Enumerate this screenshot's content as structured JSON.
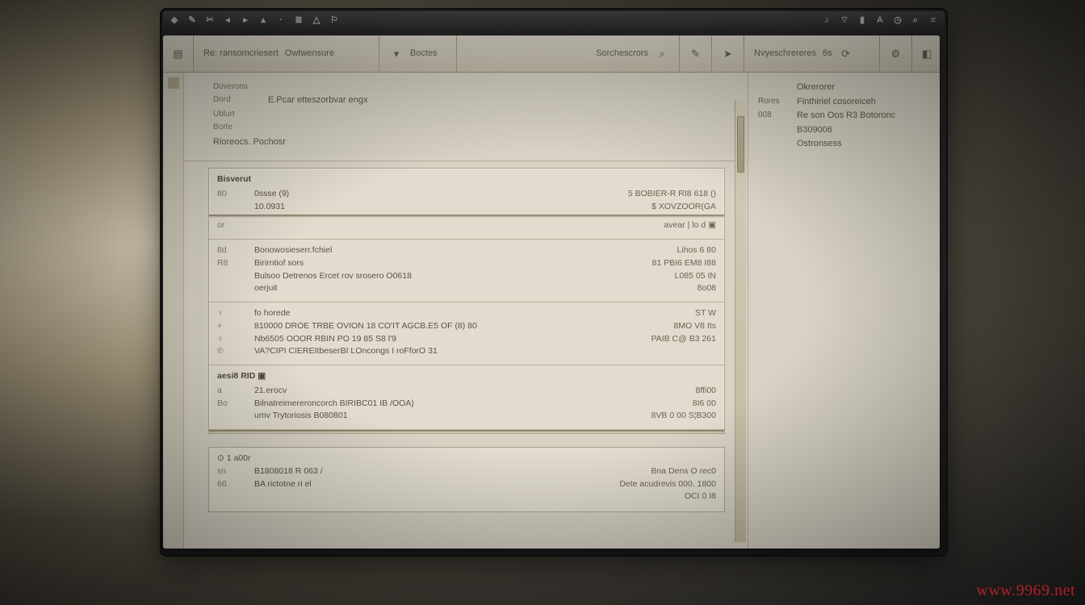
{
  "watermark": "www.9969.net",
  "menubar": {
    "left_icons": [
      "apple",
      "cut",
      "copy",
      "back",
      "fwd",
      "up",
      "sep",
      "list",
      "warn",
      "flag"
    ],
    "right_icons": [
      "vol",
      "wifi",
      "batt",
      "ime",
      "clock",
      "search",
      "menu"
    ]
  },
  "toolbar": {
    "slot_home_icon": "home",
    "slot_a_label1": "Re: ransomcriesert",
    "slot_a_label2": "Owtwensure",
    "slot_a_drop_icon": "chevron-down",
    "slot_b_label": "Boctes",
    "slot_search_label": "Sorchescrors",
    "slot_search_icon": "search",
    "slot_tool1_icon": "pencil",
    "slot_tool2_icon": "arrow",
    "slot_c_label": "Nvyeschrereres",
    "slot_c_value": "6s",
    "slot_c_icon": "refresh",
    "slot_d_icon": "gear",
    "slot_e_icon": "panel"
  },
  "header": {
    "rows": [
      {
        "k": "Doverons",
        "v": ""
      },
      {
        "k": "Dord",
        "v": "E.Pcar etteszorbvar engx"
      },
      {
        "k": "Ublurt",
        "v": ""
      },
      {
        "k": "Borte",
        "v": ""
      }
    ],
    "footer": "Rioreocs. Pochosr"
  },
  "sidebar": {
    "rows": [
      {
        "k": "",
        "v": "Okrerorer"
      },
      {
        "k": "Rores",
        "v": "Finthiriel cosoreiceh"
      },
      {
        "k": "008",
        "v": "Re son Oos  R3   Botoronc"
      },
      {
        "k": "",
        "v": "B309006"
      },
      {
        "k": "",
        "v": "Ostronsess"
      }
    ]
  },
  "records": {
    "blocks": [
      {
        "title": "Bisverut",
        "lines": [
          {
            "c1": "80",
            "c2": "0ssse (9)",
            "c3": "5 BOBIER-R RI8 618 ()"
          },
          {
            "c1": "",
            "c2": "10.0931",
            "c3": "$ XOVZOOR(GA"
          },
          {
            "c1": "or",
            "c2": "",
            "c3": "avear | lo d   ▣",
            "hr": true
          }
        ]
      },
      {
        "lines": [
          {
            "c1": "8d",
            "c2": "Bonowosieserr.fchiel",
            "c3": "Lihos  6  80"
          },
          {
            "c1": "R8",
            "c2": "Birirntiof sors",
            "c3": "81  PBI6  EM8  I88"
          },
          {
            "c1": "",
            "c2": "Bulsoo           Detrenos Ercet      rov srosero O0618",
            "c3": "L085  05  IN"
          },
          {
            "c1": "",
            "c2": "oerjuit",
            "c3": "8o08"
          }
        ]
      },
      {
        "lines": [
          {
            "c1": "♀",
            "c2": "fo horede",
            "c3": "ST W"
          },
          {
            "c1": "+",
            "c2": "810000         DROE TRBE OVION 18   CO'IT AGCB.E5     OF  (8)  80",
            "c3": "8MO V8  Its"
          },
          {
            "c1": "♀",
            "c2": "Nb6505         OOOR  RBIN PO 19        85                              S8 l'9",
            "c3": "PAIB C@  B3  261"
          },
          {
            "c1": "℗",
            "c2": "VA?CIPI CIEREItbeserBI LOncongs  I roFforO 31",
            "c3": ""
          }
        ]
      },
      {
        "title": "aesi8  RID  ▣",
        "lines": [
          {
            "c1": "a",
            "c2": "21.erocv",
            "c3": "8ffi00"
          },
          {
            "c1": "Bo",
            "c2": "Bilnatreimereroncorch     BIRIBC01     IB /OOA)",
            "c3": "8I6 00"
          },
          {
            "c1": "",
            "c2": "umv  Trytoriosis           B080801",
            "c3": "8VB 0 00   S¦B300"
          }
        ]
      }
    ],
    "bottom_bar": "▣"
  },
  "footer_block": {
    "title": "⊙  1 a00r",
    "lines": [
      {
        "c1": "sn",
        "c2": "B1808018  R 063 /",
        "c3": "Bna  Dens O rec0"
      },
      {
        "c1": "66",
        "c2": "BA  rictotne  ri el",
        "c3": "Dete  acudrevis 000.   1800  OCI 0 I8"
      }
    ]
  }
}
